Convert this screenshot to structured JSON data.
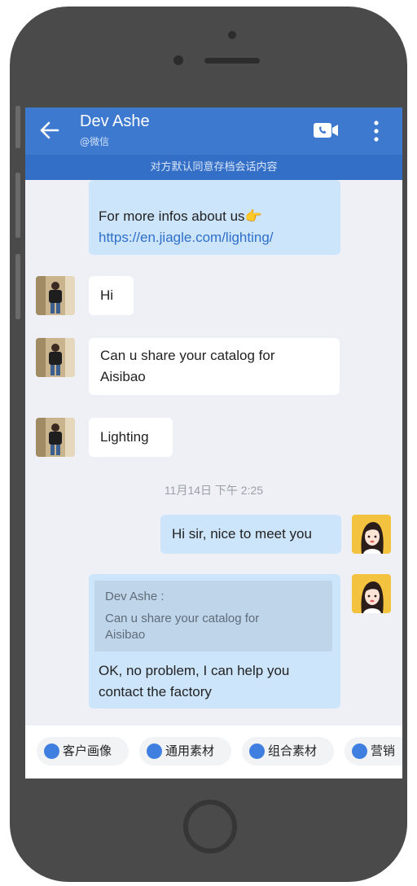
{
  "header": {
    "contact_name": "Dev Ashe",
    "contact_source": "@微信",
    "notice": "对方默认同意存档会话内容"
  },
  "messages": [
    {
      "side": "out",
      "line1": "For more infos about us👉",
      "link": "https://en.jiagle.com/lighting/"
    },
    {
      "side": "in",
      "text": "Hi"
    },
    {
      "side": "in",
      "line1": "Can u share your catalog for",
      "line2": "Aisibao"
    },
    {
      "side": "in",
      "text": "Lighting"
    },
    {
      "side": "out",
      "text": "Hi sir, nice to meet you"
    },
    {
      "side": "out",
      "quote_author": "Dev Ashe :",
      "quote_line1": "Can u share your catalog for",
      "quote_line2": "Aisibao",
      "line1": "OK, no problem, I can help you",
      "line2": "contact the factory"
    }
  ],
  "timestamp": "11月14日 下午 2:25",
  "toolbar": {
    "chips": [
      "客户画像",
      "通用素材",
      "组合素材",
      "营销"
    ]
  },
  "colors": {
    "header": "#3c79cf",
    "notice_bar": "#336fc6",
    "bubble_out": "#cde5fb",
    "bubble_in": "#ffffff",
    "link": "#2f6fc8"
  }
}
